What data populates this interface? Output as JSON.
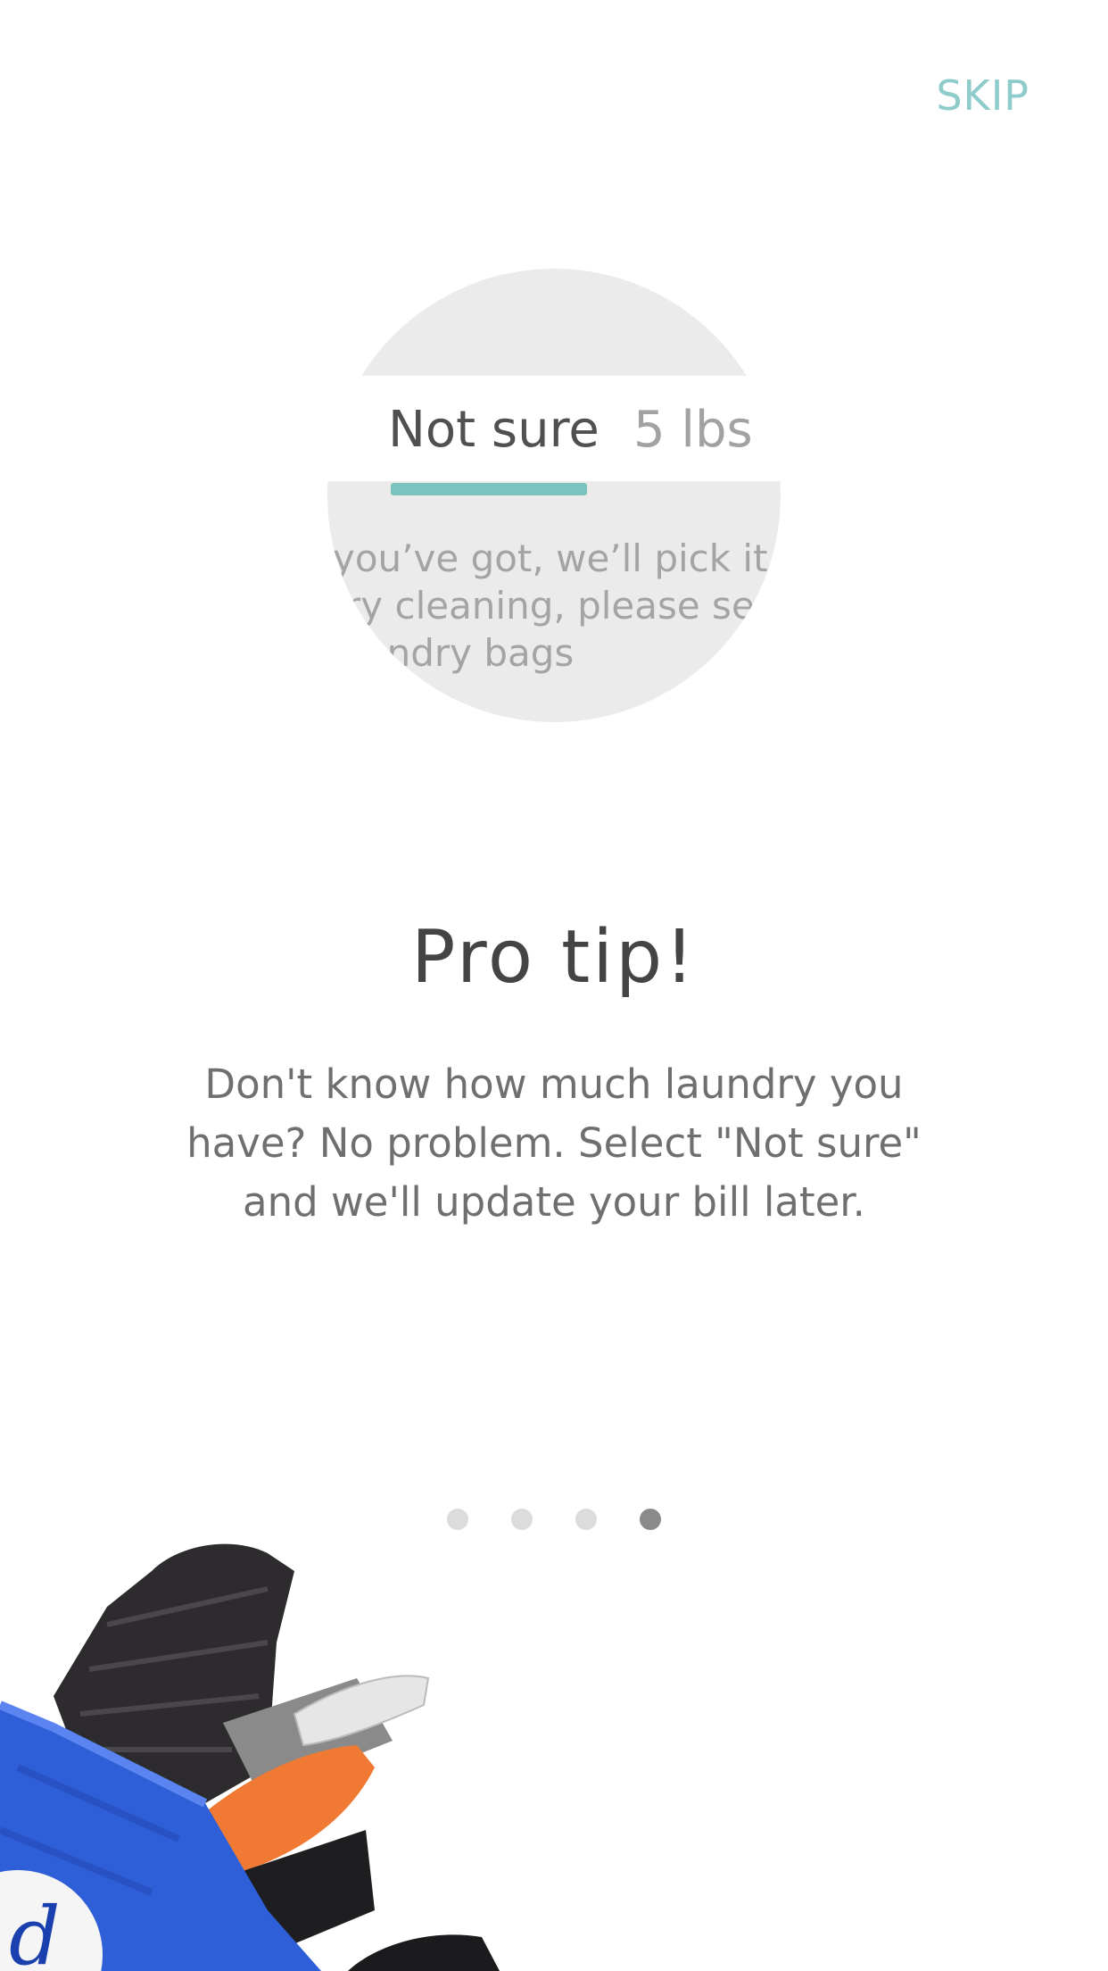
{
  "header": {
    "skip_label": "SKIP"
  },
  "illustration_circle": {
    "selected_option": "Not sure",
    "other_option": "5 lbs",
    "background_lines": [
      "you’ve got, we’ll pick it u",
      "ry cleaning, please ser",
      "undry bags"
    ]
  },
  "content": {
    "title": "Pro tip!",
    "description": "Don't know how much laundry you have? No problem. Select \"Not sure\" and we'll update your bill later."
  },
  "pager": {
    "count": 4,
    "active_index": 3
  },
  "colors": {
    "accent": "#7bc3c1",
    "skip": "#8ecbcb",
    "bag": "#2f5fd8"
  },
  "icons": {
    "bag_image": "laundry-bag-with-clothes"
  }
}
